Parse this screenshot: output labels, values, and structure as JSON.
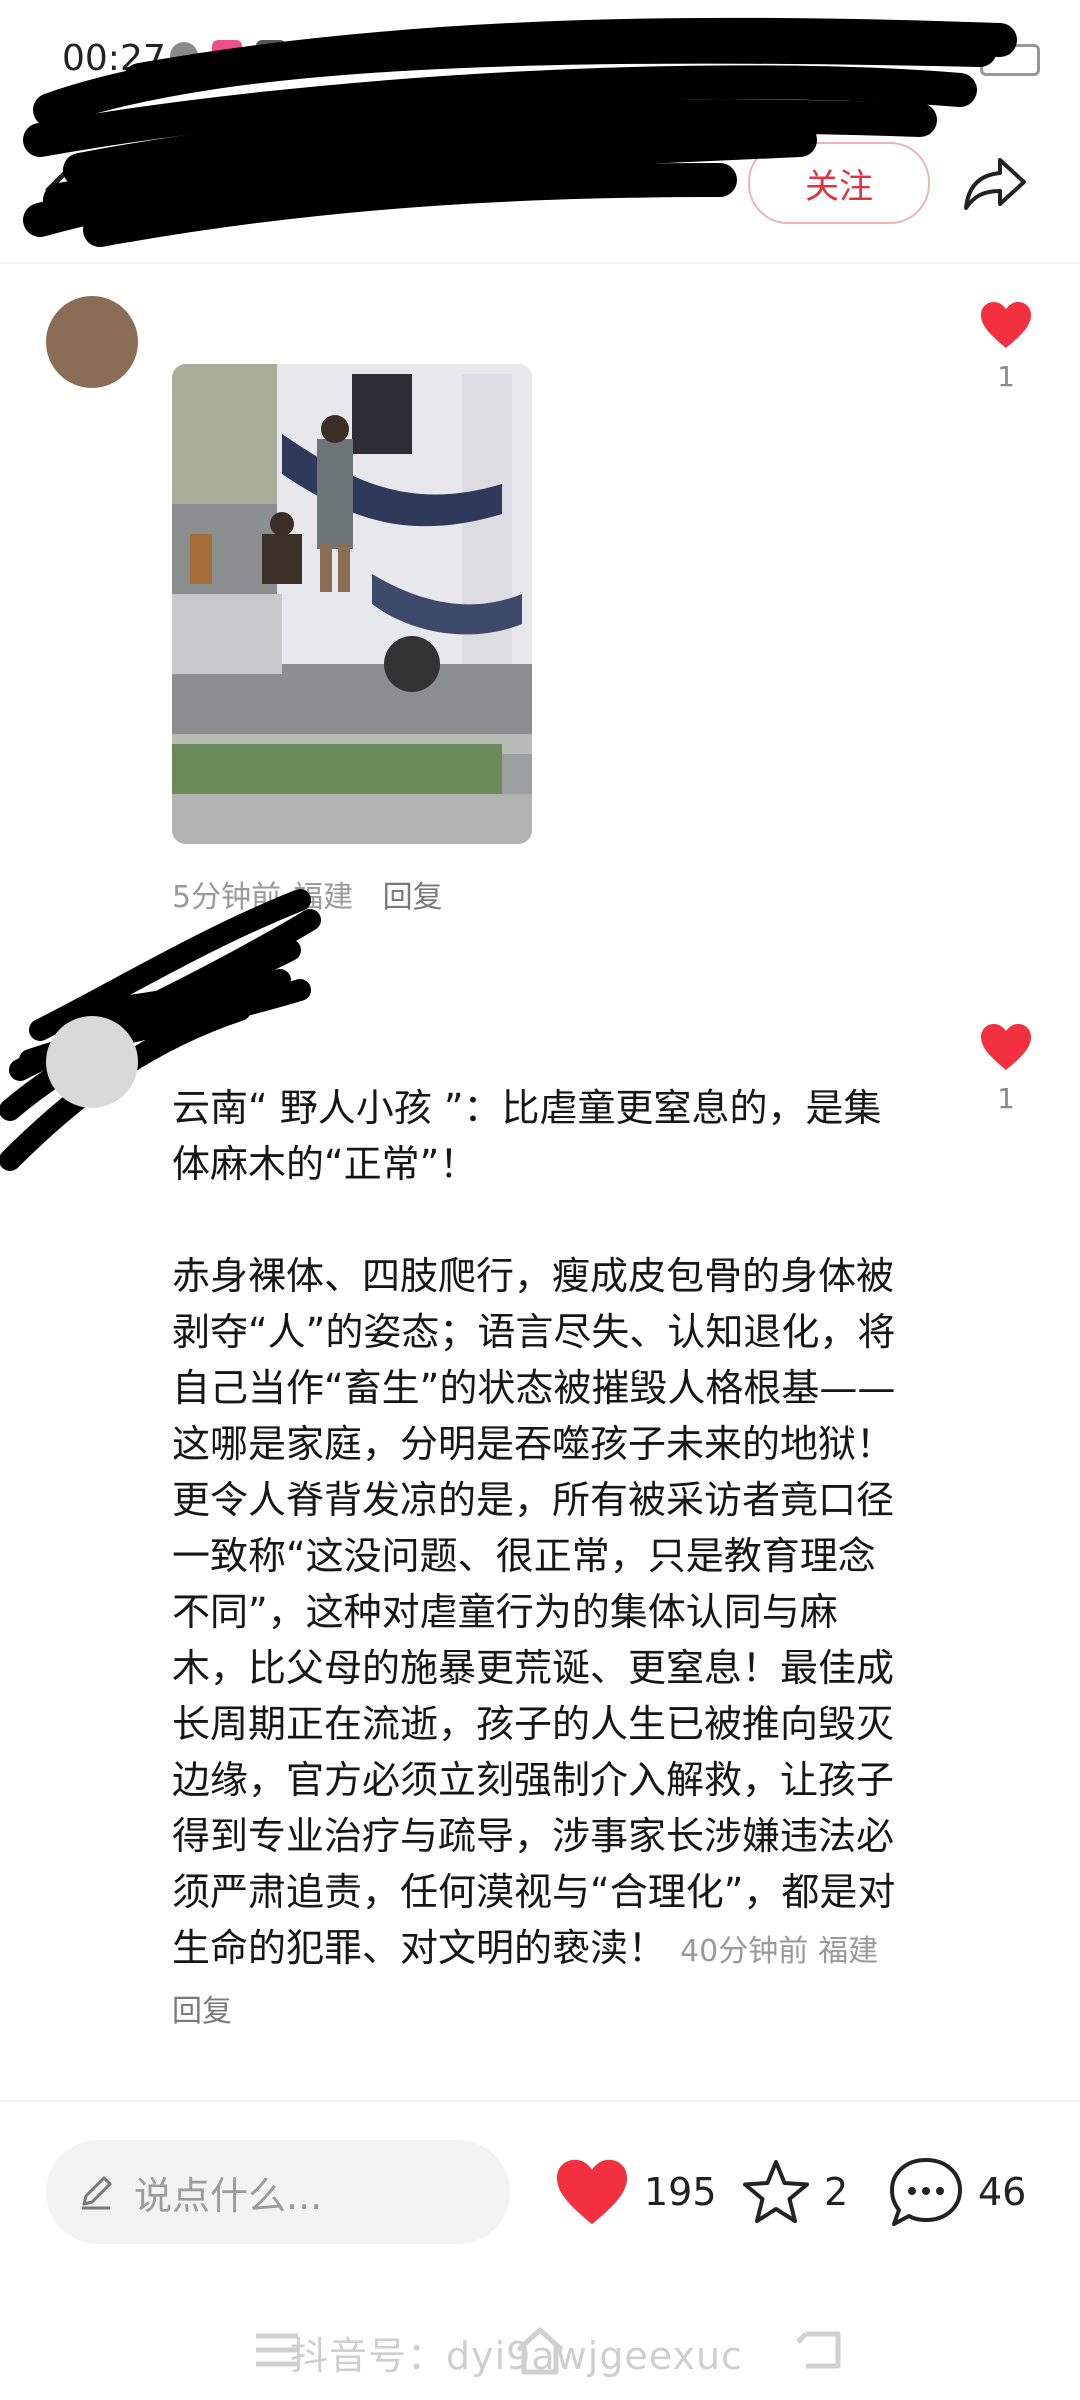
{
  "status_bar": {
    "time": "00:27"
  },
  "header": {
    "follow_label": "关注"
  },
  "comments": [
    {
      "likes": "1",
      "time": "5分钟前",
      "location": "福建",
      "reply_label": "回复"
    },
    {
      "likes": "1",
      "paragraphs": [
        "云南“ 野人小孩 ”：比虐童更窒息的，是集体麻木的“正常”！",
        "赤身裸体、四肢爬行，瘦成皮包骨的身体被剥夺“人”的姿态；语言尽失、认知退化，将自己当作“畜生”的状态被摧毁人格根基——这哪是家庭，分明是吞噬孩子未来的地狱！更令人脊背发凉的是，所有被采访者竟口径一致称“这没问题、很正常，只是教育理念不同”，这种对虐童行为的集体认同与麻木，比父母的施暴更荒诞、更窒息！最佳成长周期正在流逝，孩子的人生已被推向毁灭边缘，官方必须立刻强制介入解救，让孩子得到专业治疗与疏导，涉事家长涉嫌违法必须严肃追责，任何漠视与“合理化”，都是对生命的犯罪、对文明的亵渎！"
      ],
      "time": "40分钟前",
      "location": "福建",
      "reply_label": "回复"
    }
  ],
  "bottom_bar": {
    "input_placeholder": "说点什么...",
    "like_count": "195",
    "favorite_count": "2",
    "comment_count": "46"
  },
  "watermark": "抖音号：dyi9awjgeexuc",
  "colors": {
    "like_red": "#f2303f",
    "follow_red": "#e0333f"
  }
}
